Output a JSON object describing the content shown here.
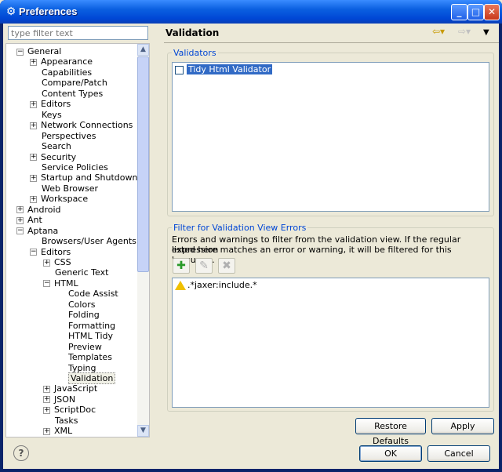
{
  "window": {
    "title": "Preferences",
    "icon": "gear-icon"
  },
  "filter": {
    "placeholder": "type filter text"
  },
  "tree": [
    {
      "label": "General",
      "depth": 0,
      "exp": "-"
    },
    {
      "label": "Appearance",
      "depth": 1,
      "exp": "+"
    },
    {
      "label": "Capabilities",
      "depth": 1,
      "exp": ""
    },
    {
      "label": "Compare/Patch",
      "depth": 1,
      "exp": ""
    },
    {
      "label": "Content Types",
      "depth": 1,
      "exp": ""
    },
    {
      "label": "Editors",
      "depth": 1,
      "exp": "+"
    },
    {
      "label": "Keys",
      "depth": 1,
      "exp": ""
    },
    {
      "label": "Network Connections",
      "depth": 1,
      "exp": "+"
    },
    {
      "label": "Perspectives",
      "depth": 1,
      "exp": ""
    },
    {
      "label": "Search",
      "depth": 1,
      "exp": ""
    },
    {
      "label": "Security",
      "depth": 1,
      "exp": "+"
    },
    {
      "label": "Service Policies",
      "depth": 1,
      "exp": ""
    },
    {
      "label": "Startup and Shutdown",
      "depth": 1,
      "exp": "+"
    },
    {
      "label": "Web Browser",
      "depth": 1,
      "exp": ""
    },
    {
      "label": "Workspace",
      "depth": 1,
      "exp": "+"
    },
    {
      "label": "Android",
      "depth": 0,
      "exp": "+"
    },
    {
      "label": "Ant",
      "depth": 0,
      "exp": "+"
    },
    {
      "label": "Aptana",
      "depth": 0,
      "exp": "-"
    },
    {
      "label": "Browsers/User Agents",
      "depth": 1,
      "exp": ""
    },
    {
      "label": "Editors",
      "depth": 1,
      "exp": "-"
    },
    {
      "label": "CSS",
      "depth": 2,
      "exp": "+"
    },
    {
      "label": "Generic Text",
      "depth": 2,
      "exp": ""
    },
    {
      "label": "HTML",
      "depth": 2,
      "exp": "-"
    },
    {
      "label": "Code Assist",
      "depth": 3,
      "exp": ""
    },
    {
      "label": "Colors",
      "depth": 3,
      "exp": ""
    },
    {
      "label": "Folding",
      "depth": 3,
      "exp": ""
    },
    {
      "label": "Formatting",
      "depth": 3,
      "exp": ""
    },
    {
      "label": "HTML Tidy",
      "depth": 3,
      "exp": ""
    },
    {
      "label": "Preview",
      "depth": 3,
      "exp": ""
    },
    {
      "label": "Templates",
      "depth": 3,
      "exp": ""
    },
    {
      "label": "Typing",
      "depth": 3,
      "exp": ""
    },
    {
      "label": "Validation",
      "depth": 3,
      "exp": "",
      "selected": true
    },
    {
      "label": "JavaScript",
      "depth": 2,
      "exp": "+"
    },
    {
      "label": "JSON",
      "depth": 2,
      "exp": "+"
    },
    {
      "label": "ScriptDoc",
      "depth": 2,
      "exp": "+"
    },
    {
      "label": "Tasks",
      "depth": 2,
      "exp": ""
    },
    {
      "label": "XML",
      "depth": 2,
      "exp": "+"
    },
    {
      "label": "XML",
      "depth": 2,
      "exp": "+"
    }
  ],
  "page": {
    "title": "Validation"
  },
  "validators": {
    "group_title": "Validators",
    "items": [
      "Tidy Html Validator"
    ]
  },
  "filter_group": {
    "title": "Filter for Validation View Errors",
    "desc_line1": "Errors and warnings to filter from the validation view. If the regular expression",
    "desc_line2": "listed here matches an error or warning, it will be filtered for this language.",
    "items": [
      ".*jaxer:include.*"
    ]
  },
  "buttons": {
    "restore_defaults": "Restore Defaults",
    "apply": "Apply",
    "ok": "OK",
    "cancel": "Cancel",
    "help": "?"
  }
}
